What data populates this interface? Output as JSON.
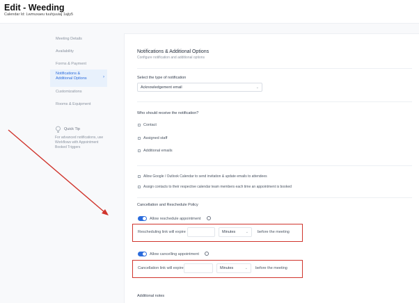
{
  "header": {
    "title": "Edit - Weeding",
    "subtitle": "Calendar Id: Lwmuxaeu tuuhjuuiaj 1ajiy5"
  },
  "sidebar": {
    "items": [
      {
        "label": "Meeting Details"
      },
      {
        "label": "Availability"
      },
      {
        "label": "Forms & Payment"
      },
      {
        "label": "Notifications & Additional Options"
      },
      {
        "label": "Customizations"
      },
      {
        "label": "Rooms & Equipment"
      }
    ],
    "quick_tip": {
      "title": "Quick Tip",
      "text": "For advanced notifications, use Workflows with Appointment Booked Triggers"
    }
  },
  "main": {
    "section_title": "Notifications & Additional Options",
    "section_subtitle": "Configure notification and additional options",
    "notification_type": {
      "label": "Select the type of notification",
      "value": "Acknowledgement email"
    },
    "receivers": {
      "label": "Who should receive the notification?",
      "options": [
        {
          "label": "Contact"
        },
        {
          "label": "Assigned staff"
        },
        {
          "label": "Additional emails"
        }
      ]
    },
    "extra_options": [
      {
        "label": "Allow Google / Outlook Calendar to send invitation & update emails to attendees"
      },
      {
        "label": "Assign contacts to their respective calendar team members each time an appointment is booked"
      }
    ],
    "policy": {
      "title": "Cancellation and Reschedule Policy",
      "reschedule": {
        "toggle_label": "Allow reschedule appointment",
        "row_label": "Rescheduling link will expire",
        "unit": "Minutes",
        "suffix": "before the meeting"
      },
      "cancel": {
        "toggle_label": "Allow cancelling appointment",
        "row_label": "Cancellation link will expire",
        "unit": "Minutes",
        "suffix": "before the meeting"
      }
    },
    "additional_notes_label": "Additional notes"
  },
  "colors": {
    "accent": "#2b6cdc",
    "highlight_box": "#d0342c",
    "annotation_arrow": "#d0342c"
  }
}
